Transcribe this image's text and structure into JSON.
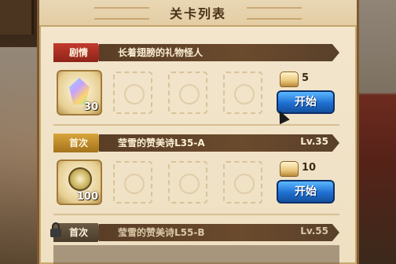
{
  "dialog": {
    "title": "关卡列表"
  },
  "stages": [
    {
      "tag": "剧情",
      "name": "长着翅膀的礼物怪人",
      "level": "",
      "reward_icon": "rainbow-crystal-icon",
      "reward_count": "30",
      "stamina_icon": "bread-icon",
      "stamina_cost": "5",
      "start_label": "开始",
      "locked": false
    },
    {
      "tag": "首次",
      "name": "莹雪的赞美诗L35-A",
      "level": "Lv.35",
      "reward_icon": "gold-medal-icon",
      "reward_count": "100",
      "stamina_icon": "bread-icon",
      "stamina_cost": "10",
      "start_label": "开始",
      "locked": false
    },
    {
      "tag": "首次",
      "name": "莹雪的赞美诗L55-B",
      "level": "Lv.55",
      "locked": true,
      "lock_icon": "lock-icon"
    }
  ],
  "colors": {
    "parchment": "#f3e6cd",
    "story_tag": "#c23a2c",
    "first_tag": "#d9a43a",
    "locked_tag": "#6b5a44",
    "start_button": "#1f6fd1"
  }
}
